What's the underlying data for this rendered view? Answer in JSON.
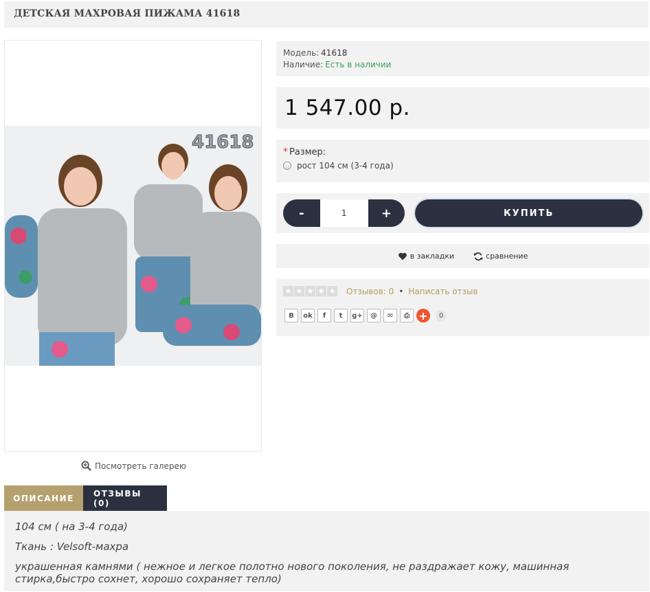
{
  "product": {
    "title": "ДЕТСКАЯ МАХРОВАЯ ПИЖАМА 41618",
    "image_label": "41618",
    "gallery_link": "Посмотреть галерею"
  },
  "info": {
    "model_label": "Модель:",
    "model_value": "41618",
    "stock_label": "Наличие:",
    "stock_value": "Есть в наличии",
    "stock_color": "#3aa15c"
  },
  "price": "1 547.00 р.",
  "options": {
    "size_label": "Размер:",
    "size_option": "рост 104 см (3-4 года)"
  },
  "cart": {
    "minus": "-",
    "quantity": "1",
    "plus": "+",
    "buy_label": "КУПИТЬ"
  },
  "actions": {
    "wishlist": "в закладки",
    "compare": "сравнение"
  },
  "reviews": {
    "rating": 0,
    "reviews_link": "Отзывов: 0",
    "separator": "•",
    "write_link": "Написать отзыв"
  },
  "share": {
    "buttons": [
      "vk-icon",
      "odnoklassniki-icon",
      "facebook-icon",
      "twitter-icon",
      "google-plus-icon",
      "mail-ru-icon",
      "email-icon",
      "print-icon"
    ],
    "count": "0"
  },
  "tabs": [
    {
      "label": "ОПИСАНИЕ"
    },
    {
      "label": "ОТЗЫВЫ (0)"
    }
  ],
  "description": [
    "104 см ( на 3-4 года)",
    "Ткань : Velsoft-махра",
    "украшенная камнями ( нежное и легкое полотно нового поколения, не раздражает кожу, машинная стирка,быстро сохнет, хорошо сохраняет тепло)"
  ],
  "colors": {
    "dark": "#2c3141",
    "accent": "#b5a16e",
    "link": "#b59d5e"
  }
}
